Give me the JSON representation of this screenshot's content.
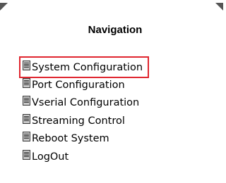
{
  "navigation": {
    "title": "Navigation",
    "items": [
      {
        "label": "System Configuration",
        "icon": "document-icon",
        "highlighted": true
      },
      {
        "label": "Port Configuration",
        "icon": "document-icon",
        "highlighted": false
      },
      {
        "label": "Vserial Configuration",
        "icon": "document-icon",
        "highlighted": false
      },
      {
        "label": "Streaming Control",
        "icon": "document-icon",
        "highlighted": false
      },
      {
        "label": "Reboot System",
        "icon": "document-icon",
        "highlighted": false
      },
      {
        "label": "LogOut",
        "icon": "document-icon",
        "highlighted": false
      }
    ],
    "highlight_color": "#e0262f"
  }
}
